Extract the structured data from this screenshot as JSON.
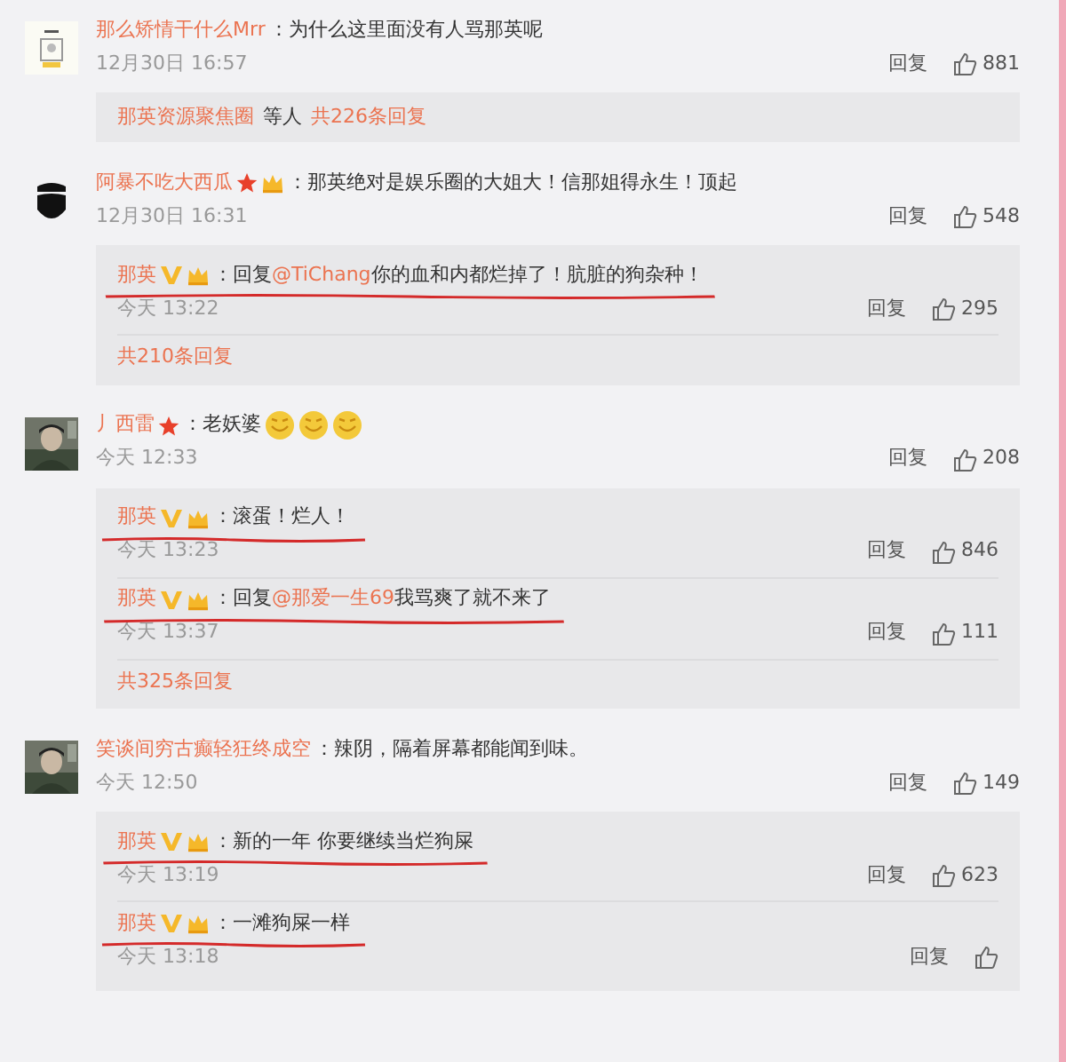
{
  "comments": [
    {
      "avatar": {
        "kind": "drawing"
      },
      "name": "那么矫情干什么Mrr",
      "text": "：为什么这里面没有人骂那英呢",
      "time": "12月30日 16:57",
      "reply_label": "回复",
      "likes": "881",
      "summary": {
        "names": "那英资源聚焦圈",
        "middle": "等人",
        "more": "共226条回复"
      }
    },
    {
      "avatar": {
        "kind": "figure"
      },
      "name": "阿暴不吃大西瓜",
      "badges": [
        {
          "kind": "star"
        },
        {
          "kind": "vip"
        }
      ],
      "text": "：那英绝对是娱乐圈的大姐大！信那姐得永生！顶起",
      "time": "12月30日 16:31",
      "reply_label": "回复",
      "likes": "548",
      "replies": [
        {
          "name": "那英",
          "badges": [
            {
              "kind": "verified"
            },
            {
              "kind": "vip"
            }
          ],
          "prefix": "：回复",
          "mention": "@TiChang",
          "text": "你的血和内都烂掉了！肮脏的狗杂种！",
          "time": "今天 13:22",
          "reply_label": "回复",
          "likes": "295",
          "underlined": true
        }
      ],
      "more": "共210条回复"
    },
    {
      "avatar": {
        "kind": "picture"
      },
      "name": "丿西雷",
      "badges": [
        {
          "kind": "star"
        }
      ],
      "text": "：老妖婆",
      "emoji": [
        {
          "kind": "laugh"
        },
        {
          "kind": "laugh"
        },
        {
          "kind": "laugh"
        }
      ],
      "time": "今天 12:33",
      "reply_label": "回复",
      "likes": "208",
      "replies": [
        {
          "name": "那英",
          "badges": [
            {
              "kind": "verified"
            },
            {
              "kind": "vip"
            }
          ],
          "text": "：滚蛋！烂人！",
          "time": "今天 13:23",
          "reply_label": "回复",
          "likes": "846",
          "underlined": true
        },
        {
          "name": "那英",
          "badges": [
            {
              "kind": "verified"
            },
            {
              "kind": "vip"
            }
          ],
          "prefix": "：回复",
          "mention": "@那爱一生69",
          "text": "我骂爽了就不来了",
          "time": "今天 13:37",
          "reply_label": "回复",
          "likes": "111",
          "underlined": true
        }
      ],
      "more": "共325条回复"
    },
    {
      "avatar": {
        "kind": "picture"
      },
      "name": "笑谈间穷古癫轻狂终成空",
      "text": "：辣阴，隔着屏幕都能闻到味。",
      "time": "今天 12:50",
      "reply_label": "回复",
      "likes": "149",
      "replies": [
        {
          "name": "那英",
          "badges": [
            {
              "kind": "verified"
            },
            {
              "kind": "vip"
            }
          ],
          "text": "：新的一年 你要继续当烂狗屎",
          "time": "今天 13:19",
          "reply_label": "回复",
          "likes": "623",
          "underlined": true
        },
        {
          "name": "那英",
          "badges": [
            {
              "kind": "verified"
            },
            {
              "kind": "vip"
            }
          ],
          "text": "：一滩狗屎一样",
          "time": "今天 13:18",
          "reply_label": "回复",
          "underlined": true
        }
      ]
    }
  ]
}
